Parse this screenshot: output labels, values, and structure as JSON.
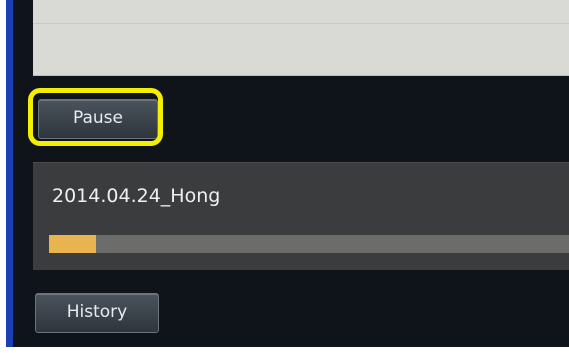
{
  "controls": {
    "pause_label": "Pause",
    "history_label": "History"
  },
  "download": {
    "file_name": "2014.04.24_Hong",
    "progress_percent": 9
  },
  "colors": {
    "highlight": "#f4ef00",
    "progress_fill": "#e8b44d",
    "panel_bg": "#0f141a",
    "left_border": "#1a3fb5"
  }
}
